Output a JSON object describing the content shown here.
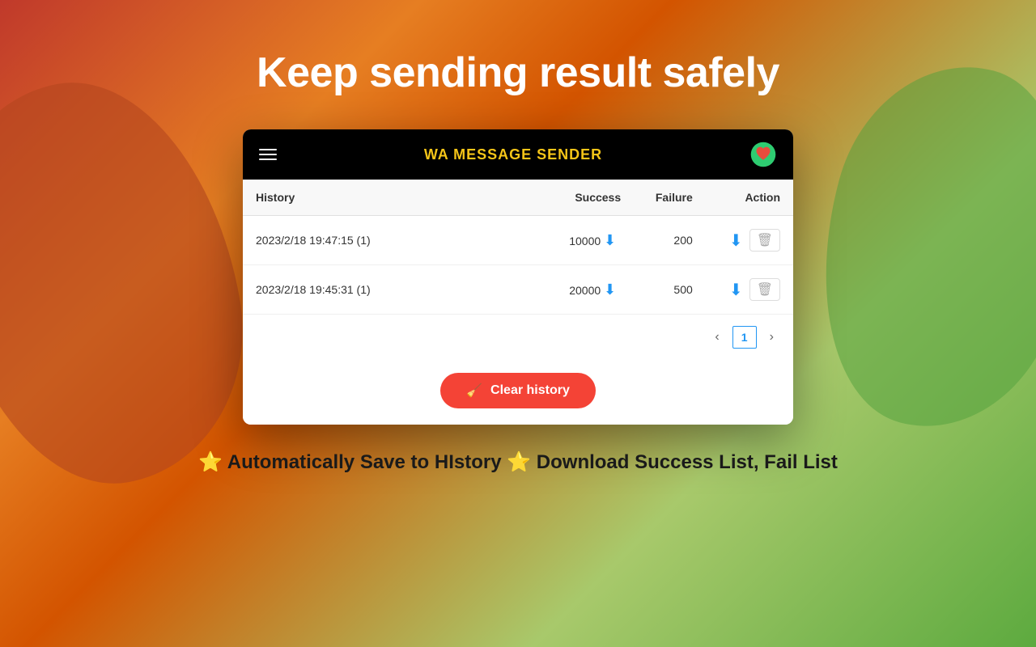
{
  "page": {
    "main_title": "Keep sending result safely",
    "background_gradient": "linear-gradient(135deg, #c0392b, #e67e22, #5daa3f)"
  },
  "app": {
    "header": {
      "title": "WA MESSAGE SENDER"
    },
    "table": {
      "columns": [
        "History",
        "Success",
        "Failure",
        "Action"
      ],
      "rows": [
        {
          "history": "2023/2/18 19:47:15 (1)",
          "success": "10000",
          "failure": "200"
        },
        {
          "history": "2023/2/18 19:45:31 (1)",
          "success": "20000",
          "failure": "500"
        }
      ],
      "pagination": {
        "current_page": "1",
        "prev_label": "‹",
        "next_label": "›"
      }
    },
    "clear_history_button": {
      "label": "Clear history",
      "icon": "🧹"
    }
  },
  "bottom_text": {
    "star1": "⭐",
    "feature1": "Automatically Save to HIstory",
    "star2": "⭐",
    "feature2": "Download Success List, Fail List"
  }
}
